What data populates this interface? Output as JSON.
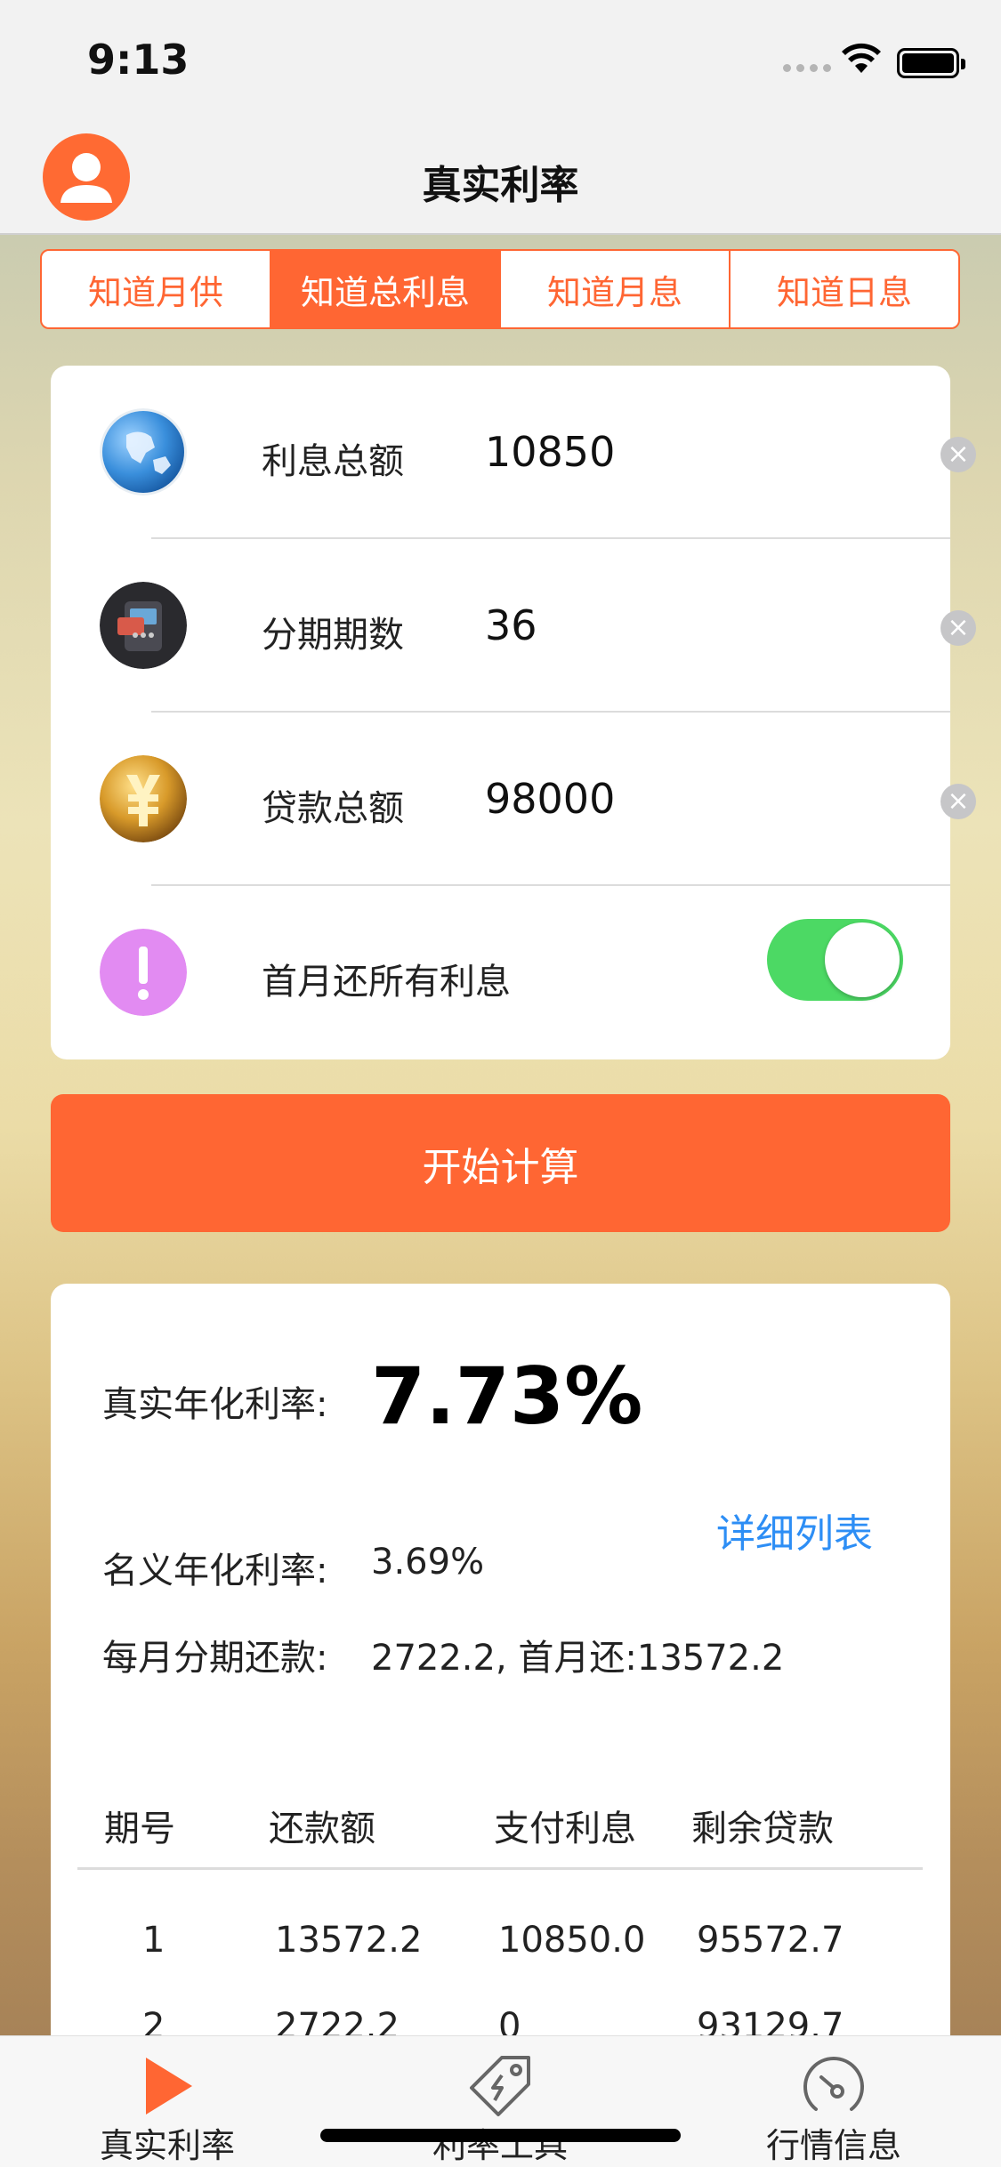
{
  "status": {
    "time": "9:13"
  },
  "nav": {
    "title": "真实利率"
  },
  "tabs": [
    {
      "label": "知道月供",
      "active": false
    },
    {
      "label": "知道总利息",
      "active": true
    },
    {
      "label": "知道月息",
      "active": false
    },
    {
      "label": "知道日息",
      "active": false
    }
  ],
  "form": {
    "rows": [
      {
        "label": "利息总额",
        "value": "10850",
        "icon": "globe-icon"
      },
      {
        "label": "分期期数",
        "value": "36",
        "icon": "card-reader-icon"
      },
      {
        "label": "贷款总额",
        "value": "98000",
        "icon": "yuan-coin-icon"
      }
    ],
    "toggle": {
      "label": "首月还所有利息",
      "on": true,
      "icon": "exclamation-icon"
    }
  },
  "calc_button": "开始计算",
  "result": {
    "real_rate_label": "真实年化利率:",
    "real_rate_value": "7.73%",
    "detail_link": "详细列表",
    "nominal_label": "名义年化利率:",
    "nominal_value": "3.69%",
    "monthly_label": "每月分期还款:",
    "monthly_value": "2722.2, 首月还:13572.2",
    "table": {
      "headers": [
        "期号",
        "还款额",
        "支付利息",
        "剩余贷款"
      ],
      "rows": [
        [
          "1",
          "13572.2",
          "10850.0",
          "95572.7"
        ],
        [
          "2",
          "2722.2",
          "0",
          "93129.7"
        ]
      ]
    }
  },
  "tabbar": [
    {
      "label": "真实利率",
      "icon": "play-icon"
    },
    {
      "label": "利率工具",
      "icon": "tag-icon"
    },
    {
      "label": "行情信息",
      "icon": "gauge-icon"
    }
  ],
  "colors": {
    "accent": "#ff6633",
    "toggle_on": "#4cd964",
    "link": "#2d8ef5"
  }
}
